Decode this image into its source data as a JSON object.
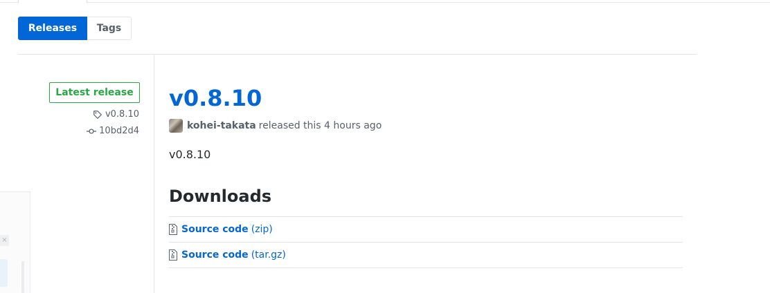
{
  "subnav": {
    "items": [
      {
        "label": "Releases",
        "selected": true
      },
      {
        "label": "Tags",
        "selected": false
      }
    ]
  },
  "release": {
    "badge": "Latest release",
    "tag": "v0.8.10",
    "commit": "10bd2d4",
    "title": "v0.8.10",
    "author": "kohei-takata",
    "released_text": "released this 4 hours ago",
    "body": "v0.8.10"
  },
  "downloads": {
    "title": "Downloads",
    "items": [
      {
        "name": "Source code",
        "format": "(zip)"
      },
      {
        "name": "Source code",
        "format": "(tar.gz)"
      }
    ]
  },
  "edge_panel": {
    "close_glyph": "×"
  },
  "colors": {
    "accent": "#0366d6",
    "success": "#28a745",
    "muted": "#586069",
    "border": "#e1e4e8"
  },
  "icons": {
    "tag": "tag-icon",
    "commit": "git-commit-icon",
    "download": "file-zip-icon",
    "close": "close-icon"
  }
}
